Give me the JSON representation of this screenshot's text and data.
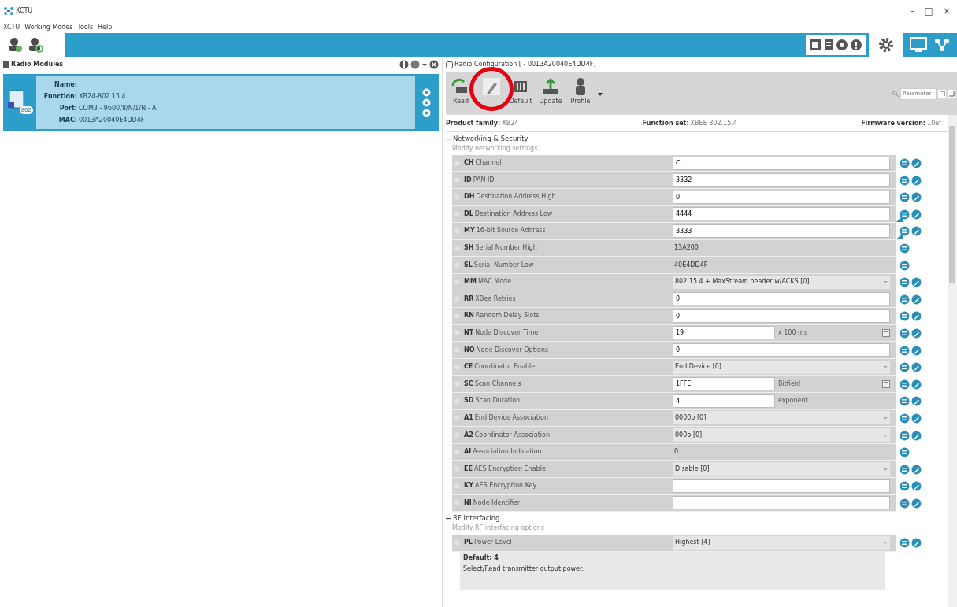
{
  "window": {
    "title": "XCTU",
    "controls": [
      "–",
      "□",
      "×"
    ]
  },
  "menu": [
    "XCTU",
    "Working Modes",
    "Tools",
    "Help"
  ],
  "modules_panel": {
    "title": "Radio Modules",
    "module": {
      "selected": true,
      "fields": [
        {
          "label": "Name:"
        },
        {
          "label": "Function:",
          "value": "XB24-802.15.4"
        },
        {
          "label": "Port:",
          "value": "COM3 - 9600/8/N/1/N - AT"
        },
        {
          "label": "MAC:",
          "value": "0013A20040E4DD4F"
        }
      ],
      "badge": "802"
    }
  },
  "config_panel": {
    "title": "Radio Configuration [ - 0013A20040E4DD4F]",
    "toolbar": [
      {
        "kind": "read",
        "label": "Read",
        "highlighted": false
      },
      {
        "kind": "write",
        "highlighted": true
      },
      {
        "kind": "default",
        "label": "Default",
        "highlighted": false
      },
      {
        "kind": "update",
        "label": "Update",
        "highlighted": false
      },
      {
        "kind": "profile",
        "label": "Profile",
        "highlighted": false
      }
    ],
    "search": {
      "placeholder": "Parameter"
    },
    "info": [
      {
        "label": "Product family:",
        "value": "XB24"
      },
      {
        "label": "Function set:",
        "value": "XBEE 802.15.4"
      },
      {
        "label": "Firmware version:",
        "value": "10ef"
      }
    ],
    "sections": [
      {
        "title": "Networking & Security",
        "subtitle": "Modify networking settings",
        "expanded": true,
        "rows": [
          {
            "code": "CH",
            "name": "Channel",
            "kind": "text",
            "value": "C",
            "writable": true,
            "changed": false
          },
          {
            "code": "ID",
            "name": "PAN ID",
            "kind": "text",
            "value": "3332",
            "writable": true,
            "changed": false
          },
          {
            "code": "DH",
            "name": "Destination Address High",
            "kind": "text",
            "value": "0",
            "writable": true,
            "changed": false
          },
          {
            "code": "DL",
            "name": "Destination Address Low",
            "kind": "text",
            "value": "4444",
            "writable": true,
            "changed": true
          },
          {
            "code": "MY",
            "name": "16-bit Source Address",
            "kind": "text",
            "value": "3333",
            "writable": true,
            "changed": true
          },
          {
            "code": "SH",
            "name": "Serial Number High",
            "kind": "readonly",
            "value": "13A200",
            "writable": false,
            "changed": false
          },
          {
            "code": "SL",
            "name": "Serial Number Low",
            "kind": "readonly",
            "value": "40E4DD4F",
            "writable": false,
            "changed": false
          },
          {
            "code": "MM",
            "name": "MAC Mode",
            "kind": "select",
            "value": "802.15.4 + MaxStream header w/ACKS [0]",
            "writable": true,
            "changed": false
          },
          {
            "code": "RR",
            "name": "XBee Retries",
            "kind": "text",
            "value": "0",
            "writable": true,
            "changed": false
          },
          {
            "code": "RN",
            "name": "Random Delay Slots",
            "kind": "text",
            "value": "0",
            "writable": true,
            "changed": false
          },
          {
            "code": "NT",
            "name": "Node Discover Time",
            "kind": "unit",
            "value": "19",
            "unit": "x 100 ms",
            "calculator": true,
            "writable": true,
            "changed": false
          },
          {
            "code": "NO",
            "name": "Node Discover Options",
            "kind": "text",
            "value": "0",
            "writable": true,
            "changed": false
          },
          {
            "code": "CE",
            "name": "Coordinator Enable",
            "kind": "select",
            "value": "End Device [0]",
            "writable": true,
            "changed": false
          },
          {
            "code": "SC",
            "name": "Scan Channels",
            "kind": "unit",
            "value": "1FFE",
            "unit": "Bitfield",
            "calculator": true,
            "writable": true,
            "changed": false
          },
          {
            "code": "SD",
            "name": "Scan Duration",
            "kind": "unit",
            "value": "4",
            "unit": "exponent",
            "calculator": false,
            "writable": true,
            "changed": false
          },
          {
            "code": "A1",
            "name": "End Device Association",
            "kind": "select",
            "value": "0000b [0]",
            "writable": true,
            "changed": false
          },
          {
            "code": "A2",
            "name": "Coordinator Association",
            "kind": "select",
            "value": "000b [0]",
            "writable": true,
            "changed": false
          },
          {
            "code": "AI",
            "name": "Association Indication",
            "kind": "readonly",
            "value": "0",
            "writable": false,
            "changed": false
          },
          {
            "code": "EE",
            "name": "AES Encryption Enable",
            "kind": "select",
            "value": "Disable [0]",
            "writable": true,
            "changed": false
          },
          {
            "code": "KY",
            "name": "AES Encryption Key",
            "kind": "text",
            "writable": true,
            "changed": false
          },
          {
            "code": "NI",
            "name": "Node Identifier",
            "kind": "text",
            "writable": true,
            "changed": false
          }
        ]
      },
      {
        "title": "RF Interfacing",
        "subtitle": "Modify RF interfacing options",
        "expanded": true,
        "rows": [
          {
            "code": "PL",
            "name": "Power Level",
            "kind": "select",
            "value": "Highest [4]",
            "writable": true,
            "changed": false,
            "detail": {
              "default": "Default: 4",
              "description": "Select/Read transmitter output power."
            }
          }
        ]
      }
    ]
  }
}
